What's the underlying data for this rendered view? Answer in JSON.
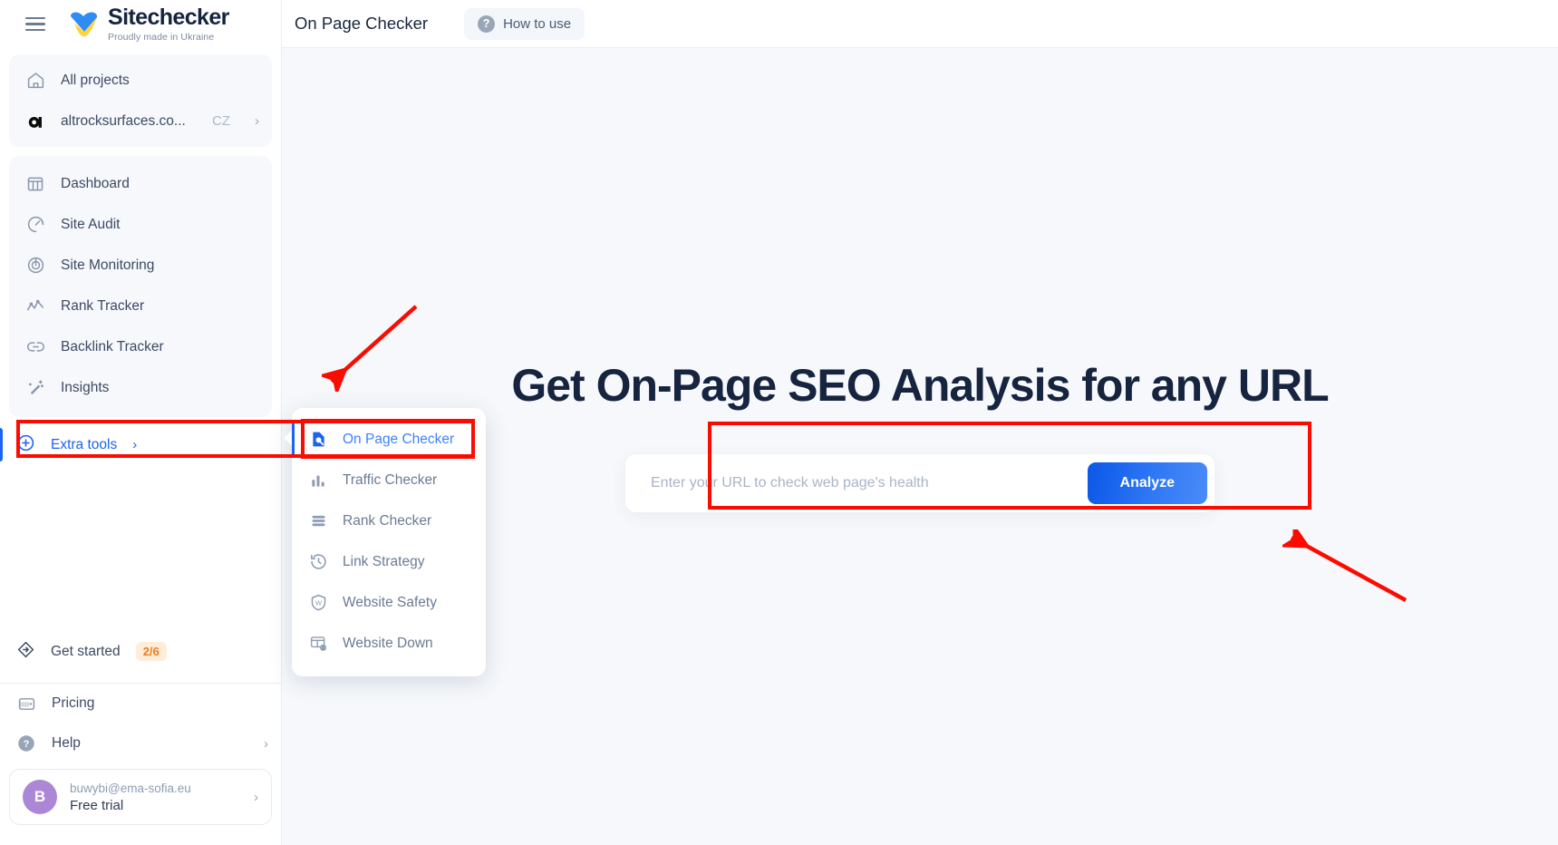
{
  "brand": {
    "name": "Sitechecker",
    "tagline": "Proudly made in Ukraine",
    "accent": "#1b63f2"
  },
  "sidebar": {
    "menu_icon": "hamburger-icon",
    "top_group": [
      {
        "icon": "home-icon",
        "label": "All projects"
      },
      {
        "icon": "project-avatar-icon",
        "label": "altrocksurfaces.co...",
        "badge": "CZ",
        "chevron": "›"
      }
    ],
    "main_group": [
      {
        "icon": "dashboard-icon",
        "label": "Dashboard"
      },
      {
        "icon": "gauge-icon",
        "label": "Site Audit"
      },
      {
        "icon": "target-icon",
        "label": "Site Monitoring"
      },
      {
        "icon": "chart-line-icon",
        "label": "Rank Tracker"
      },
      {
        "icon": "link-icon",
        "label": "Backlink Tracker"
      },
      {
        "icon": "magic-wand-icon",
        "label": "Insights"
      }
    ],
    "extra_tools": {
      "icon": "plus-circle-icon",
      "label": "Extra tools",
      "chevron": "›",
      "active": true
    },
    "get_started": {
      "icon": "diamond-arrow-icon",
      "label": "Get started",
      "badge": "2/6",
      "badge_color": "#f07c20"
    },
    "bottom_group": [
      {
        "icon": "wallet-icon",
        "label": "Pricing"
      },
      {
        "icon": "question-circle-icon",
        "label": "Help",
        "chevron": "›"
      }
    ],
    "account": {
      "avatar_initial": "B",
      "email": "buwybi@ema-sofia.eu",
      "plan": "Free trial",
      "chevron": "›"
    }
  },
  "flyout": {
    "items": [
      {
        "icon": "page-search-icon",
        "label": "On Page Checker",
        "selected": true
      },
      {
        "icon": "bar-chart-icon",
        "label": "Traffic Checker",
        "selected": false
      },
      {
        "icon": "list-rank-icon",
        "label": "Rank Checker",
        "selected": false
      },
      {
        "icon": "history-clock-icon",
        "label": "Link Strategy",
        "selected": false
      },
      {
        "icon": "shield-w-icon",
        "label": "Website Safety",
        "selected": false
      },
      {
        "icon": "browser-eye-icon",
        "label": "Website Down",
        "selected": false
      }
    ]
  },
  "topbar": {
    "title": "On Page Checker",
    "how_to_use": {
      "icon": "question-circle-icon",
      "label": "How to use"
    }
  },
  "main": {
    "heading": "Get On-Page SEO Analysis for any URL",
    "search": {
      "placeholder": "Enter your URL to check web page's health",
      "value": "",
      "button_label": "Analyze"
    }
  },
  "annotations": {
    "color": "#fb0b00",
    "rects": [
      "extra-tools-row",
      "on-page-checker-menu-item",
      "url-search-box"
    ],
    "arrows": [
      "arrow-to-extra-tools",
      "arrow-to-url-search-box"
    ]
  }
}
